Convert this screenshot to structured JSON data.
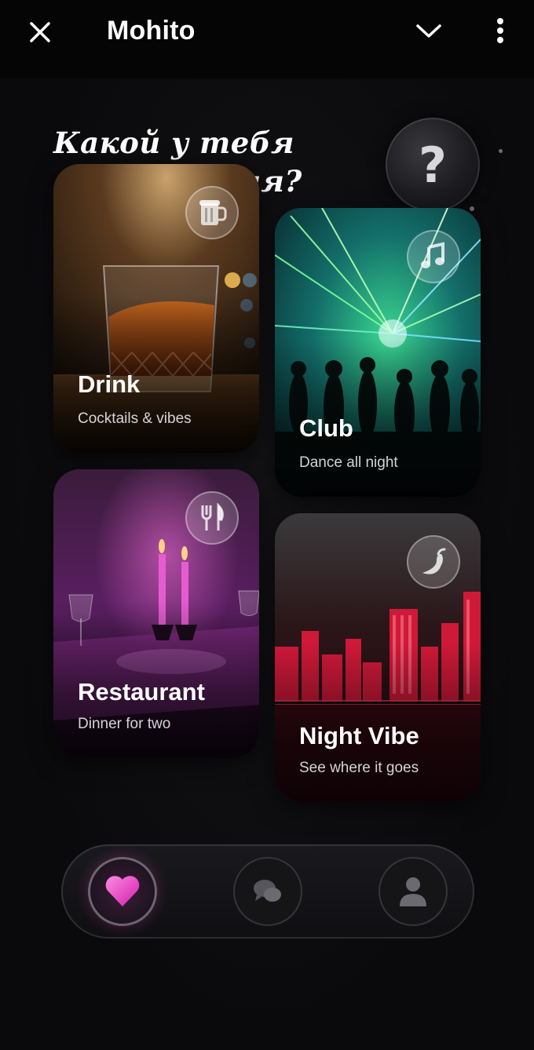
{
  "header": {
    "title": "Mohito",
    "close_icon": "close-icon",
    "collapse_icon": "chevron-down-icon",
    "menu_icon": "more-vertical-icon"
  },
  "main": {
    "headline_line1": "Какой у тебя",
    "headline_line2": "вайб сегодня?",
    "help_glyph": "?",
    "cards": [
      {
        "title": "Drink",
        "subtitle": "Cocktails & vibes",
        "icon": "beer-mug-icon"
      },
      {
        "title": "Club",
        "subtitle": "Dance all night",
        "icon": "music-note-icon"
      },
      {
        "title": "Restaurant",
        "subtitle": "Dinner for two",
        "icon": "fork-knife-icon"
      },
      {
        "title": "Night Vibe",
        "subtitle": "See where it goes",
        "icon": "chili-pepper-icon"
      }
    ]
  },
  "bottom_nav": {
    "items": [
      {
        "icon": "heart-icon",
        "active": true
      },
      {
        "icon": "chat-bubbles-icon",
        "active": false
      },
      {
        "icon": "profile-icon",
        "active": false
      }
    ]
  },
  "colors": {
    "background": "#0b0b0d",
    "accent_pink": "#ff4fd0",
    "text": "#ffffff"
  }
}
